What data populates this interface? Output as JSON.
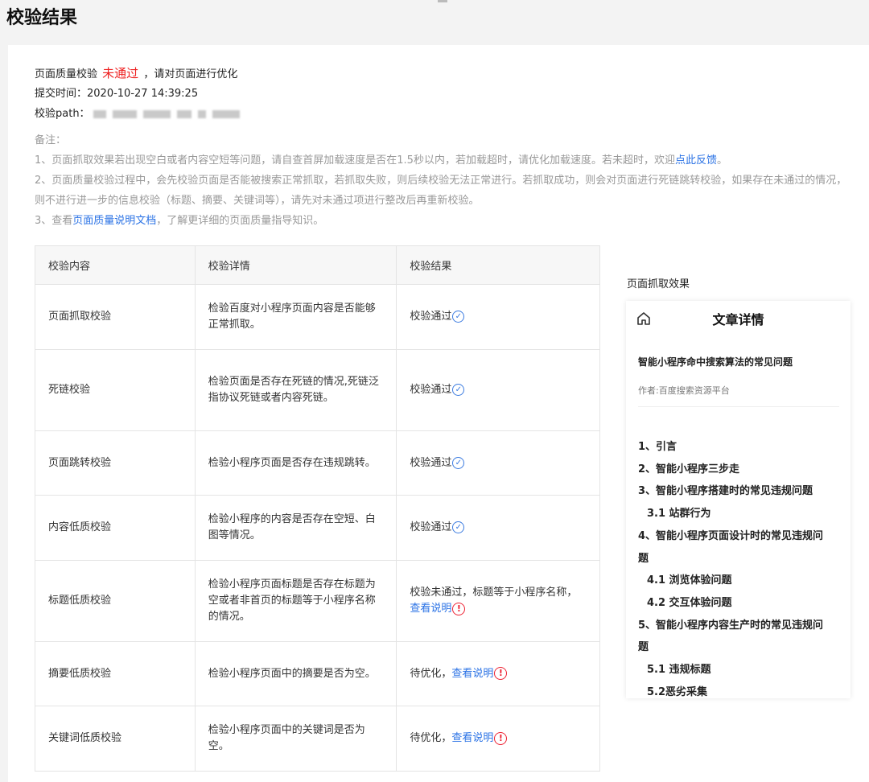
{
  "page_title": "校验结果",
  "status": {
    "prefix": "页面质量校验",
    "result": "未通过",
    "suffix": "，请对页面进行优化"
  },
  "submit": {
    "label": "提交时间：",
    "value": "2020-10-27 14:39:25"
  },
  "path": {
    "label": "校验path："
  },
  "notes": {
    "title": "备注：",
    "n1_text": "1、页面抓取效果若出现空白或者内容空短等问题，请自查首屏加载速度是否在1.5秒以内，若加载超时，请优化加载速度。若未超时，欢迎",
    "n1_link": "点此反馈",
    "n1_end": "。",
    "n2_text": "2、页面质量校验过程中，会先校验页面是否能被搜索正常抓取，若抓取失败，则后续校验无法正常进行。若抓取成功，则会对页面进行死链跳转校验，如果存在未通过的情况，则不进行进一步的信息校验（标题、摘要、关键词等），请先对未通过项进行整改后再重新校验。",
    "n3_pre": "3、查看",
    "n3_link": "页面质量说明文档",
    "n3_end": "，了解更详细的页面质量指导知识。"
  },
  "table": {
    "headers": [
      "校验内容",
      "校验详情",
      "校验结果"
    ],
    "rows": [
      {
        "item": "页面抓取校验",
        "detail": "检验百度对小程序页面内容是否能够正常抓取。",
        "result": "校验通过"
      },
      {
        "item": "死链校验",
        "detail": "检验页面是否存在死链的情况,死链泛指协议死链或者内容死链。",
        "result": "校验通过"
      },
      {
        "item": "页面跳转校验",
        "detail": "检验小程序页面是否存在违规跳转。",
        "result": "校验通过"
      },
      {
        "item": "内容低质校验",
        "detail": "检验小程序的内容是否存在空短、白图等情况。",
        "result": "校验通过"
      },
      {
        "item": "标题低质校验",
        "detail": "检验小程序页面标题是否存在标题为空或者非首页的标题等于小程序名称的情况。",
        "result": "校验未通过，标题等于小程序名称，",
        "link": "查看说明"
      },
      {
        "item": "摘要低质校验",
        "detail": "检验小程序页面中的摘要是否为空。",
        "result": "待优化，",
        "link": "查看说明"
      },
      {
        "item": "关键词低质校验",
        "detail": "检验小程序页面中的关键词是否为空。",
        "result": "待优化，",
        "link": "查看说明"
      }
    ]
  },
  "preview": {
    "label": "页面抓取效果",
    "phone_title": "文章详情",
    "article_title": "智能小程序命中搜索算法的常见问题",
    "author": "作者:百度搜索资源平台",
    "toc": [
      "1、引言",
      "2、智能小程序三步走",
      "3、智能小程序搭建时的常见违规问题",
      "3.1 站群行为",
      "4、智能小程序页面设计时的常见违规问",
      "题",
      "4.1 浏览体验问题",
      "4.2 交互体验问题",
      "5、智能小程序内容生产时的常见违规问",
      "题",
      "5.1 违规标题",
      "5.2恶劣采集"
    ]
  },
  "icons": {
    "ok": "check-circle-icon",
    "warn": "exclamation-circle-icon",
    "home": "home-icon"
  },
  "colors": {
    "fail_red": "#ee2222",
    "link_blue": "#2a72e5",
    "ok_blue": "#3b7be0"
  }
}
